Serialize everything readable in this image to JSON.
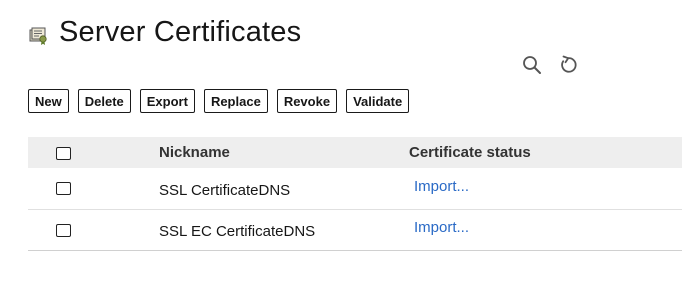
{
  "page": {
    "title": "Server Certificates"
  },
  "tool_icons": {
    "search": "search-icon",
    "refresh": "refresh-icon"
  },
  "toolbar": {
    "new_label": "New",
    "delete_label": "Delete",
    "export_label": "Export",
    "replace_label": "Replace",
    "revoke_label": "Revoke",
    "validate_label": "Validate"
  },
  "table": {
    "headers": {
      "nickname": "Nickname",
      "status": "Certificate status"
    },
    "rows": [
      {
        "nickname": "SSL CertificateDNS",
        "status": "Import..."
      },
      {
        "nickname": "SSL EC CertificateDNS",
        "status": "Import..."
      }
    ]
  },
  "colors": {
    "link": "#2a6ac6",
    "header_bg": "#eeeeee",
    "text": "#161616"
  }
}
